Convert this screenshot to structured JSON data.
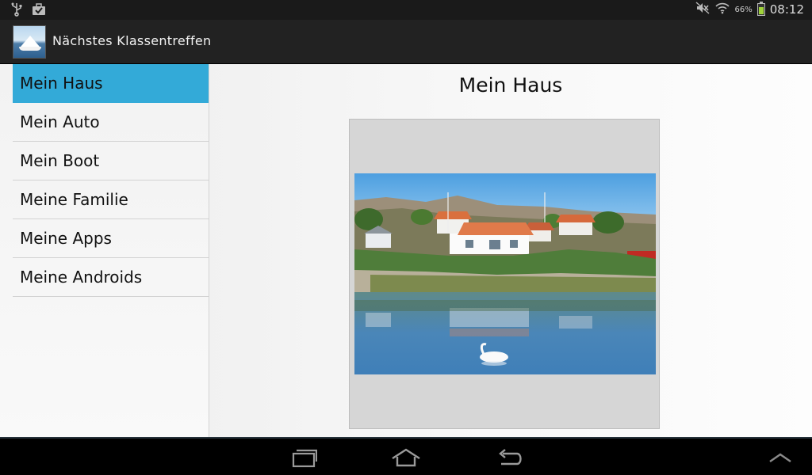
{
  "status_bar": {
    "icons_left": [
      "usb-icon",
      "briefcase-icon"
    ],
    "icons_right": [
      "mute-icon",
      "wifi-icon",
      "battery-icon"
    ],
    "battery_text": "66%",
    "battery_level": 0.66,
    "time": "08:12"
  },
  "action_bar": {
    "title": "Nächstes Klassentreffen",
    "icon": "sailboat-app-icon"
  },
  "sidebar": {
    "items": [
      {
        "label": "Mein Haus",
        "selected": true
      },
      {
        "label": "Mein Auto",
        "selected": false
      },
      {
        "label": "Mein Boot",
        "selected": false
      },
      {
        "label": "Meine Familie",
        "selected": false
      },
      {
        "label": "Meine Apps",
        "selected": false
      },
      {
        "label": "Meine Androids",
        "selected": false
      }
    ]
  },
  "detail": {
    "title": "Mein Haus",
    "image": "house-by-lake-photo"
  },
  "nav_bar": {
    "buttons": [
      "recent-apps-icon",
      "home-icon",
      "back-icon",
      "up-chevron-icon"
    ]
  },
  "colors": {
    "accent": "#33aad8",
    "action_bar": "#222222",
    "status_bar": "#1a1a1a"
  }
}
